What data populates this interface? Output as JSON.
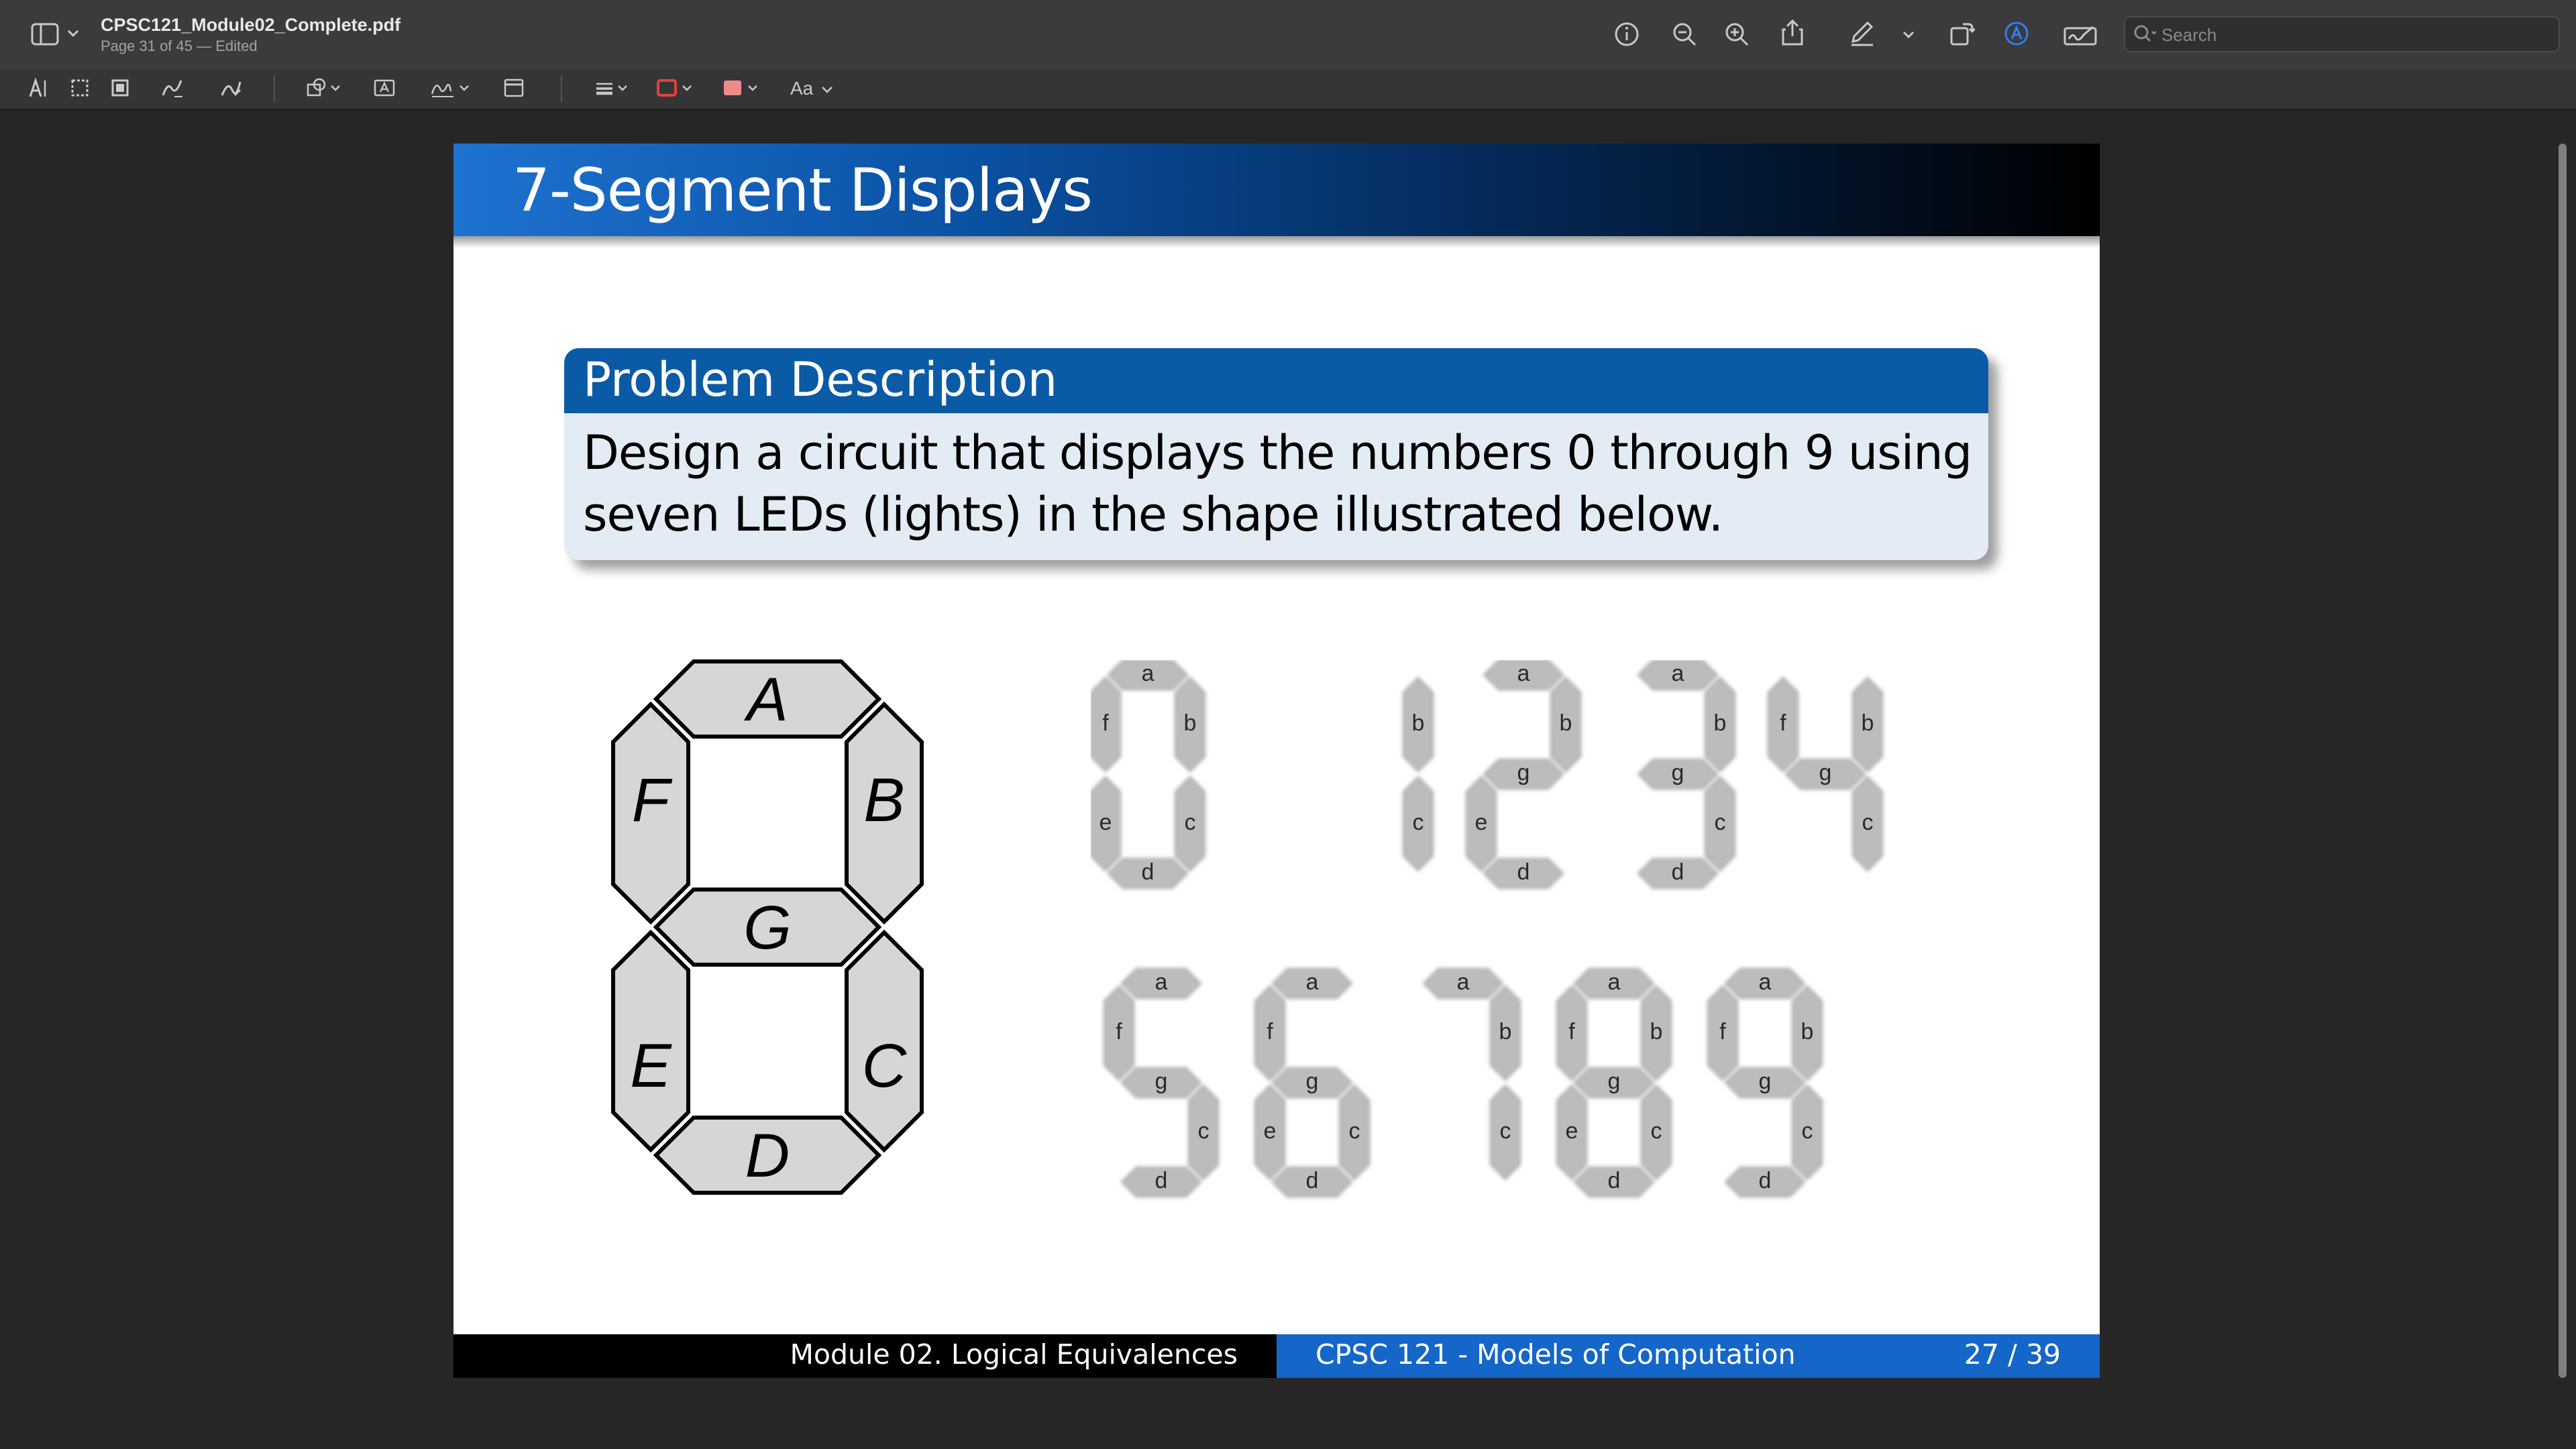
{
  "window": {
    "document_title": "CPSC121_Module02_Complete.pdf",
    "subtitle": "Page 31 of 45 — Edited",
    "search_placeholder": "Search"
  },
  "toolbar": {
    "text_style_label": "Aa"
  },
  "slide": {
    "title": "7-Segment Displays",
    "block": {
      "title": "Problem Description",
      "body": "Design a circuit that displays the numbers 0 through 9 using seven LEDs (lights) in the shape illustrated below."
    },
    "big_segments": [
      {
        "id": "a",
        "label": "A"
      },
      {
        "id": "b",
        "label": "B"
      },
      {
        "id": "c",
        "label": "C"
      },
      {
        "id": "d",
        "label": "D"
      },
      {
        "id": "e",
        "label": "E"
      },
      {
        "id": "f",
        "label": "F"
      },
      {
        "id": "g",
        "label": "G"
      }
    ],
    "digits": [
      {
        "digit": "0",
        "segments": [
          "a",
          "b",
          "c",
          "d",
          "e",
          "f"
        ]
      },
      {
        "digit": "1",
        "segments": [
          "b",
          "c"
        ]
      },
      {
        "digit": "2",
        "segments": [
          "a",
          "b",
          "g",
          "e",
          "d"
        ]
      },
      {
        "digit": "3",
        "segments": [
          "a",
          "b",
          "g",
          "c",
          "d"
        ]
      },
      {
        "digit": "4",
        "segments": [
          "f",
          "g",
          "b",
          "c"
        ]
      },
      {
        "digit": "5",
        "segments": [
          "a",
          "f",
          "g",
          "c",
          "d"
        ]
      },
      {
        "digit": "6",
        "segments": [
          "a",
          "f",
          "g",
          "e",
          "c",
          "d"
        ]
      },
      {
        "digit": "7",
        "segments": [
          "a",
          "b",
          "c"
        ]
      },
      {
        "digit": "8",
        "segments": [
          "a",
          "b",
          "c",
          "d",
          "e",
          "f",
          "g"
        ]
      },
      {
        "digit": "9",
        "segments": [
          "a",
          "b",
          "c",
          "d",
          "f",
          "g"
        ]
      }
    ],
    "footer": {
      "module": "Module 02. Logical Equivalences",
      "course": "CPSC 121 - Models of Computation",
      "page": "27 / 39"
    }
  }
}
